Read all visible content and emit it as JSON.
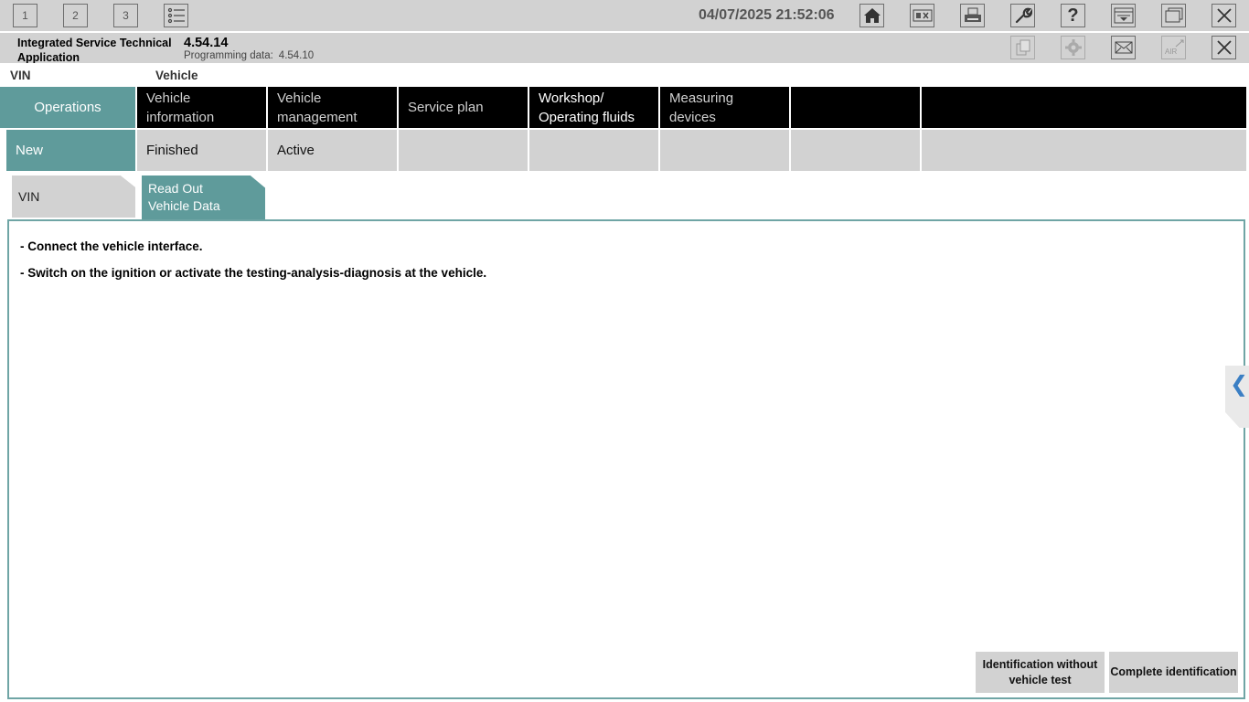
{
  "toolbar": {
    "workspaces": [
      "1",
      "2",
      "3"
    ],
    "datetime": "04/07/2025 21:52:06",
    "icons": [
      "list-icon",
      "home-icon",
      "vin-card-icon",
      "print-icon",
      "wrench-icon",
      "help-icon",
      "dropdown-panel-icon",
      "window-icon",
      "close-icon"
    ],
    "help_glyph": "?"
  },
  "appinfo": {
    "app_name": "Integrated Service Technical Application",
    "version": "4.54.14",
    "programming_label": "Programming data:",
    "programming_value": "4.54.10"
  },
  "vehicle_line": {
    "vin_label": "VIN",
    "vehicle_label": "Vehicle"
  },
  "main_tabs": [
    {
      "label": "Operations"
    },
    {
      "label": "Vehicle information"
    },
    {
      "label": "Vehicle management"
    },
    {
      "label": "Service plan"
    },
    {
      "label": "Workshop/ Operating fluids"
    },
    {
      "label": "Measuring devices"
    }
  ],
  "sub_tabs": [
    {
      "label": "New"
    },
    {
      "label": "Finished"
    },
    {
      "label": "Active"
    }
  ],
  "step_tabs": {
    "vin": "VIN",
    "read_out": "Read Out Vehicle Data"
  },
  "instructions": [
    "- Connect the vehicle interface.",
    "- Switch on the ignition or activate the testing-analysis-diagnosis at the vehicle."
  ],
  "buttons": {
    "identification_without_test": "Identification without vehicle test",
    "complete_identification": "Complete identification"
  },
  "side_arrow": "❮",
  "colors": {
    "accent": "#5f9b9b",
    "toolbar": "#d2d2d2",
    "nav": "#000000"
  }
}
